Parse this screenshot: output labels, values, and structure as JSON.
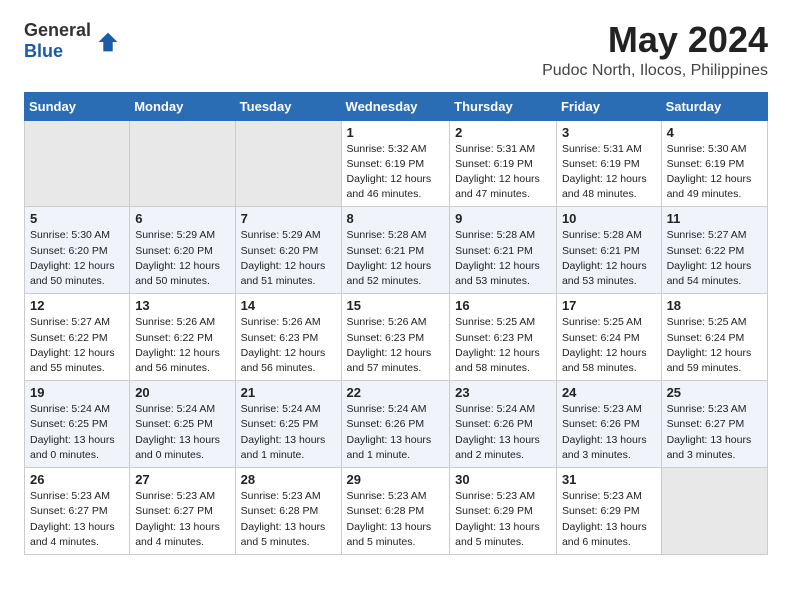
{
  "header": {
    "logo_general": "General",
    "logo_blue": "Blue",
    "month_year": "May 2024",
    "location": "Pudoc North, Ilocos, Philippines"
  },
  "weekdays": [
    "Sunday",
    "Monday",
    "Tuesday",
    "Wednesday",
    "Thursday",
    "Friday",
    "Saturday"
  ],
  "weeks": [
    [
      {
        "day": "",
        "info": ""
      },
      {
        "day": "",
        "info": ""
      },
      {
        "day": "",
        "info": ""
      },
      {
        "day": "1",
        "info": "Sunrise: 5:32 AM\nSunset: 6:19 PM\nDaylight: 12 hours\nand 46 minutes."
      },
      {
        "day": "2",
        "info": "Sunrise: 5:31 AM\nSunset: 6:19 PM\nDaylight: 12 hours\nand 47 minutes."
      },
      {
        "day": "3",
        "info": "Sunrise: 5:31 AM\nSunset: 6:19 PM\nDaylight: 12 hours\nand 48 minutes."
      },
      {
        "day": "4",
        "info": "Sunrise: 5:30 AM\nSunset: 6:19 PM\nDaylight: 12 hours\nand 49 minutes."
      }
    ],
    [
      {
        "day": "5",
        "info": "Sunrise: 5:30 AM\nSunset: 6:20 PM\nDaylight: 12 hours\nand 50 minutes."
      },
      {
        "day": "6",
        "info": "Sunrise: 5:29 AM\nSunset: 6:20 PM\nDaylight: 12 hours\nand 50 minutes."
      },
      {
        "day": "7",
        "info": "Sunrise: 5:29 AM\nSunset: 6:20 PM\nDaylight: 12 hours\nand 51 minutes."
      },
      {
        "day": "8",
        "info": "Sunrise: 5:28 AM\nSunset: 6:21 PM\nDaylight: 12 hours\nand 52 minutes."
      },
      {
        "day": "9",
        "info": "Sunrise: 5:28 AM\nSunset: 6:21 PM\nDaylight: 12 hours\nand 53 minutes."
      },
      {
        "day": "10",
        "info": "Sunrise: 5:28 AM\nSunset: 6:21 PM\nDaylight: 12 hours\nand 53 minutes."
      },
      {
        "day": "11",
        "info": "Sunrise: 5:27 AM\nSunset: 6:22 PM\nDaylight: 12 hours\nand 54 minutes."
      }
    ],
    [
      {
        "day": "12",
        "info": "Sunrise: 5:27 AM\nSunset: 6:22 PM\nDaylight: 12 hours\nand 55 minutes."
      },
      {
        "day": "13",
        "info": "Sunrise: 5:26 AM\nSunset: 6:22 PM\nDaylight: 12 hours\nand 56 minutes."
      },
      {
        "day": "14",
        "info": "Sunrise: 5:26 AM\nSunset: 6:23 PM\nDaylight: 12 hours\nand 56 minutes."
      },
      {
        "day": "15",
        "info": "Sunrise: 5:26 AM\nSunset: 6:23 PM\nDaylight: 12 hours\nand 57 minutes."
      },
      {
        "day": "16",
        "info": "Sunrise: 5:25 AM\nSunset: 6:23 PM\nDaylight: 12 hours\nand 58 minutes."
      },
      {
        "day": "17",
        "info": "Sunrise: 5:25 AM\nSunset: 6:24 PM\nDaylight: 12 hours\nand 58 minutes."
      },
      {
        "day": "18",
        "info": "Sunrise: 5:25 AM\nSunset: 6:24 PM\nDaylight: 12 hours\nand 59 minutes."
      }
    ],
    [
      {
        "day": "19",
        "info": "Sunrise: 5:24 AM\nSunset: 6:25 PM\nDaylight: 13 hours\nand 0 minutes."
      },
      {
        "day": "20",
        "info": "Sunrise: 5:24 AM\nSunset: 6:25 PM\nDaylight: 13 hours\nand 0 minutes."
      },
      {
        "day": "21",
        "info": "Sunrise: 5:24 AM\nSunset: 6:25 PM\nDaylight: 13 hours\nand 1 minute."
      },
      {
        "day": "22",
        "info": "Sunrise: 5:24 AM\nSunset: 6:26 PM\nDaylight: 13 hours\nand 1 minute."
      },
      {
        "day": "23",
        "info": "Sunrise: 5:24 AM\nSunset: 6:26 PM\nDaylight: 13 hours\nand 2 minutes."
      },
      {
        "day": "24",
        "info": "Sunrise: 5:23 AM\nSunset: 6:26 PM\nDaylight: 13 hours\nand 3 minutes."
      },
      {
        "day": "25",
        "info": "Sunrise: 5:23 AM\nSunset: 6:27 PM\nDaylight: 13 hours\nand 3 minutes."
      }
    ],
    [
      {
        "day": "26",
        "info": "Sunrise: 5:23 AM\nSunset: 6:27 PM\nDaylight: 13 hours\nand 4 minutes."
      },
      {
        "day": "27",
        "info": "Sunrise: 5:23 AM\nSunset: 6:27 PM\nDaylight: 13 hours\nand 4 minutes."
      },
      {
        "day": "28",
        "info": "Sunrise: 5:23 AM\nSunset: 6:28 PM\nDaylight: 13 hours\nand 5 minutes."
      },
      {
        "day": "29",
        "info": "Sunrise: 5:23 AM\nSunset: 6:28 PM\nDaylight: 13 hours\nand 5 minutes."
      },
      {
        "day": "30",
        "info": "Sunrise: 5:23 AM\nSunset: 6:29 PM\nDaylight: 13 hours\nand 5 minutes."
      },
      {
        "day": "31",
        "info": "Sunrise: 5:23 AM\nSunset: 6:29 PM\nDaylight: 13 hours\nand 6 minutes."
      },
      {
        "day": "",
        "info": ""
      }
    ]
  ]
}
